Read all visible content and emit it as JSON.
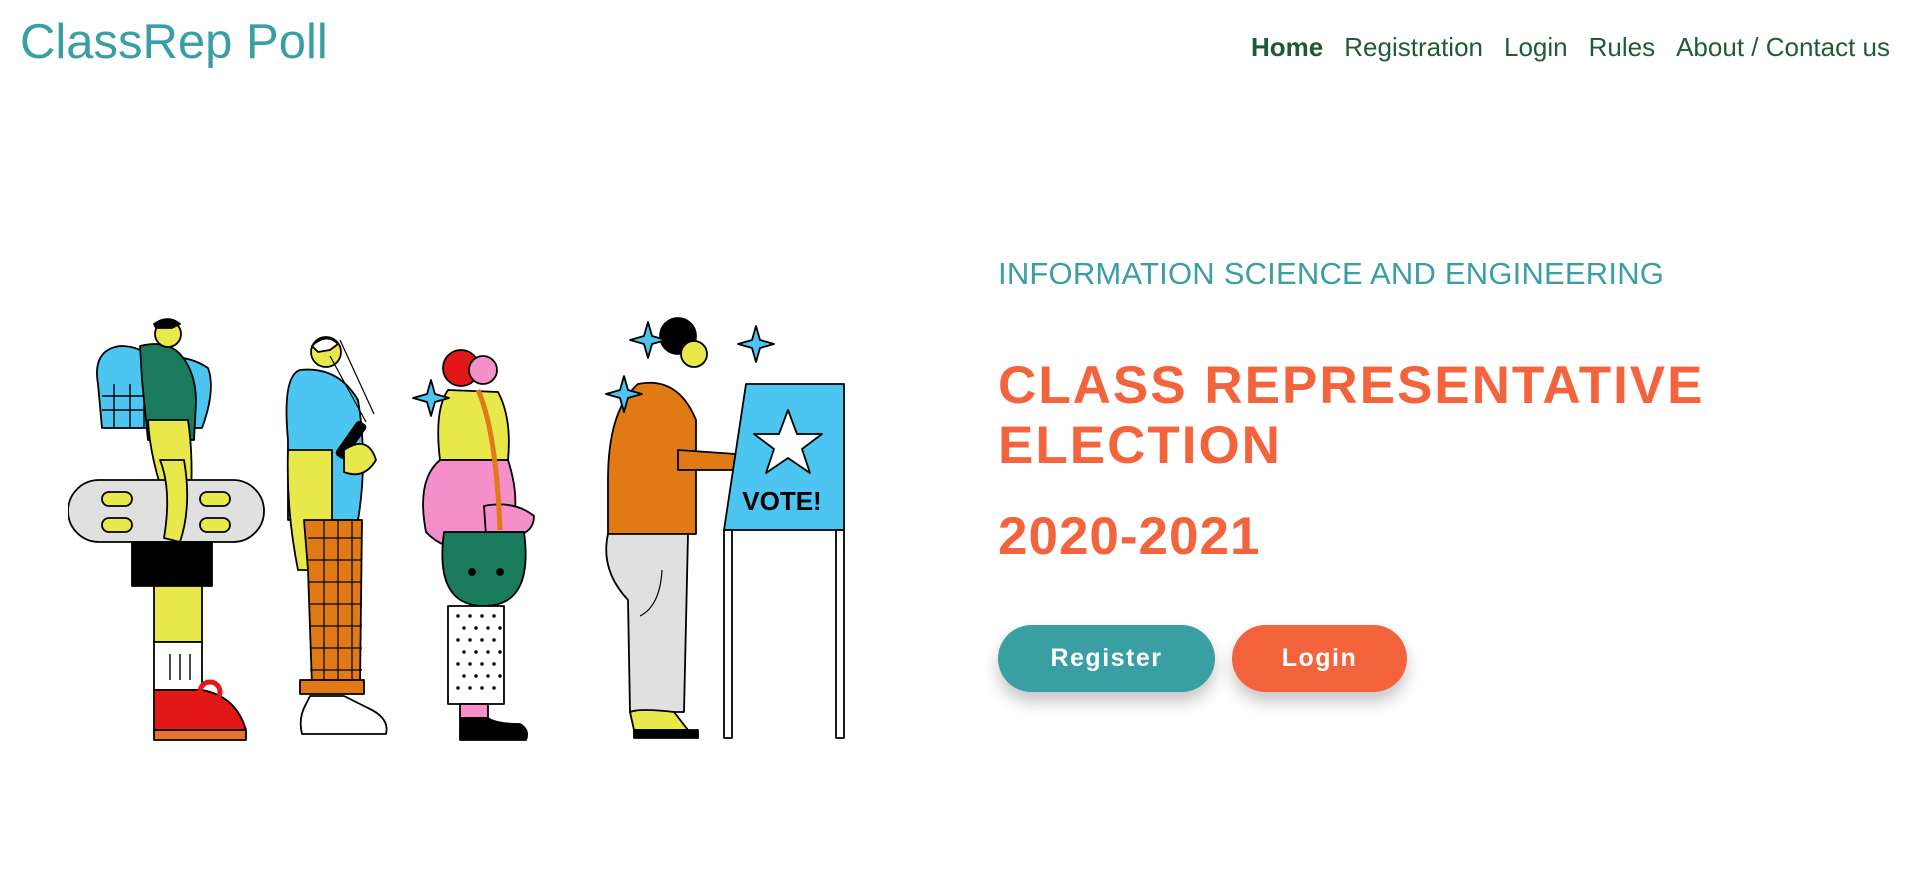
{
  "brand": "ClassRep Poll",
  "nav": {
    "home": "Home",
    "registration": "Registration",
    "login": "Login",
    "rules": "Rules",
    "about": "About / Contact us"
  },
  "hero": {
    "department": "INFORMATION SCIENCE AND ENGINEERING",
    "title": "CLASS REPRESENTATIVE ELECTION",
    "year": "2020-2021",
    "register_label": "Register",
    "login_label": "Login"
  },
  "illustration": {
    "booth_label": "VOTE!"
  },
  "colors": {
    "teal": "#3a9fa3",
    "orange": "#f4643c",
    "nav_green": "#1e5c37"
  }
}
